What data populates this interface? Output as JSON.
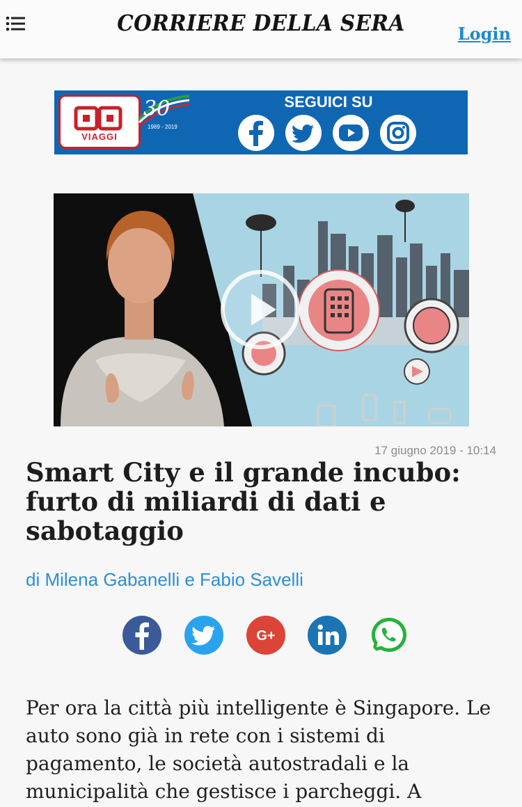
{
  "header": {
    "menu_icon": "hamburger-list-icon",
    "masthead": "CORRIERE DELLA SERA",
    "login": "Login"
  },
  "ad": {
    "brand": "VIAGGI",
    "anniversary": "30",
    "years": "1989 - 2019",
    "follow_label": "SEGUICI SU",
    "social": [
      "facebook-icon",
      "twitter-icon",
      "youtube-icon",
      "instagram-icon"
    ],
    "background_color": "#0f67b3"
  },
  "video": {
    "play_icon": "play-icon"
  },
  "article": {
    "date": "17 giugno 2019 - 10:14",
    "title": "Smart City e il grande incubo: furto di miliardi di dati e sabotaggio",
    "byline": "di Milena Gabanelli e Fabio Savelli",
    "body": "Per ora la città più intelligente è Singapore. Le auto sono già in rete con i sistemi di pagamento, le società autostradali e la municipalità che gestisce i parcheggi. A"
  },
  "share": [
    {
      "name": "facebook",
      "color": "#3a5a99"
    },
    {
      "name": "twitter",
      "color": "#2aa3ef"
    },
    {
      "name": "google-plus",
      "color": "#db4437"
    },
    {
      "name": "linkedin",
      "color": "#1b74b3"
    },
    {
      "name": "whatsapp",
      "color": "#23b33a"
    }
  ],
  "colors": {
    "accent": "#1c8ad0",
    "byline": "#2b8fd6"
  }
}
